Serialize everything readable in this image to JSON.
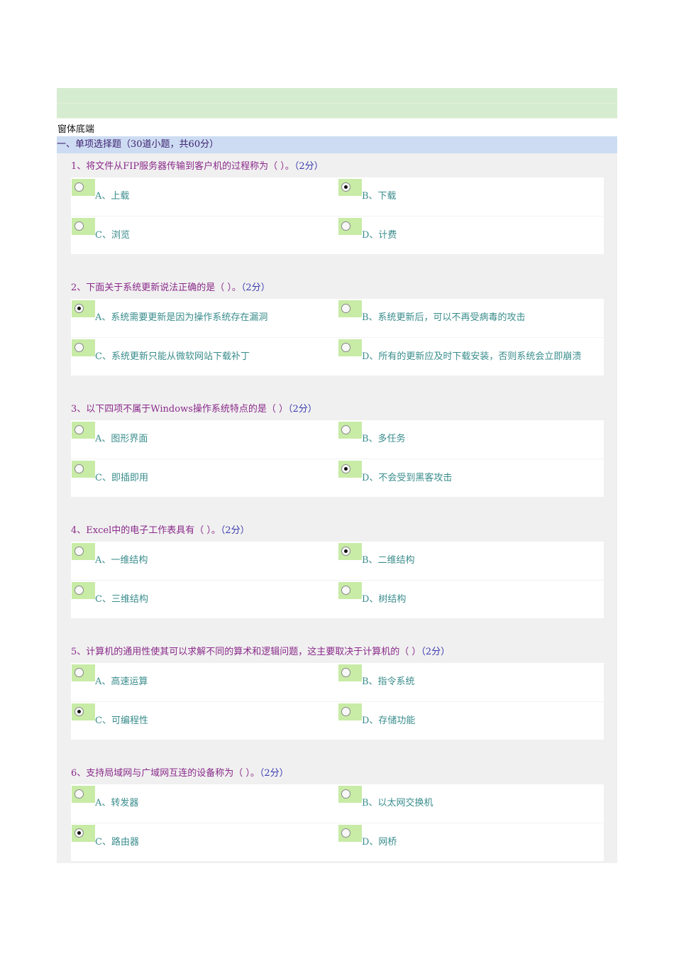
{
  "form_end": "窗体底端",
  "section_title": "一、单项选择题（30道小题，共60分）",
  "questions": [
    {
      "text": "1、将文件从FIP服务器传输到客户机的过程称为（ ）。",
      "score": "（2分）",
      "options": [
        "A、上载",
        "B、下载",
        "C、浏览",
        "D、计费"
      ],
      "selected": 1
    },
    {
      "text": "2、下面关于系统更新说法正确的是（ ）。",
      "score": "（2分）",
      "options": [
        "A、系统需要更新是因为操作系统存在漏洞",
        "B、系统更新后，可以不再受病毒的攻击",
        "C、系统更新只能从微软网站下载补丁",
        "D、所有的更新应及时下载安装，否则系统会立即崩溃"
      ],
      "selected": 0
    },
    {
      "text": "3、以下四项不属于Windows操作系统特点的是（ ）",
      "score": "（2分）",
      "options": [
        "A、图形界面",
        "B、多任务",
        "C、即插即用",
        "D、不会受到黑客攻击"
      ],
      "selected": 3
    },
    {
      "text": "4、Excel中的电子工作表具有（ ）。",
      "score": "（2分）",
      "options": [
        "A、一维结构",
        "B、二维结构",
        "C、三维结构",
        "D、树结构"
      ],
      "selected": 1
    },
    {
      "text": "5、计算机的通用性使其可以求解不同的算术和逻辑问题，这主要取决于计算机的（ ）",
      "score": "（2分）",
      "options": [
        "A、高速运算",
        "B、指令系统",
        "C、可编程性",
        "D、存储功能"
      ],
      "selected": 2
    },
    {
      "text": "6、支持局域网与广域网互连的设备称为（ ）。",
      "score": "（2分）",
      "options": [
        "A、转发器",
        "B、以太网交换机",
        "C、路由器",
        "D、网桥"
      ],
      "selected": 2
    }
  ]
}
